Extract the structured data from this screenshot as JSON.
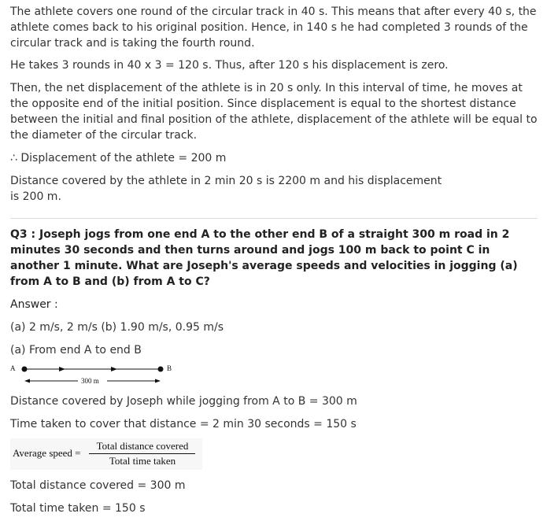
{
  "paragraphs": {
    "p1": "The athlete covers one round of the circular track in 40 s. This means that after every 40 s, the athlete comes back to his original position. Hence, in 140 s he had completed 3 rounds of the circular track and is taking the fourth round.",
    "p2": "He takes 3 rounds in 40 x 3 = 120 s. Thus, after 120 s his displacement is zero.",
    "p3": "Then, the net displacement of the athlete is in 20 s only. In this interval of time, he moves at the opposite end of the initial position. Since displacement is equal to the shortest distance between the initial and final position of the athlete, displacement of the athlete will be equal to the diameter of the circular track.",
    "p4": "∴ Displacement of the athlete = 200 m",
    "p5": "Distance covered by the athlete in 2 min 20 s is 2200 m and his displacement is 200 m."
  },
  "question": "Q3 : Joseph jogs from one end A to the other end B of a straight 300 m road in 2 minutes 30 seconds and then turns around and jogs 100 m back to point C in another 1 minute. What are Joseph's average speeds and velocities in jogging (a) from A to B and (b) from A to C?",
  "answer": {
    "label": "Answer :",
    "result": "(a) 2 m/s, 2 m/s (b) 1.90 m/s, 0.95 m/s",
    "part_a": "(a) From end A to end B",
    "figure": {
      "point_a": "A",
      "point_b": "B",
      "distance": "300 m"
    },
    "distance_line": "Distance covered by Joseph while jogging from A to B = 300 m",
    "time_line": "Time taken to cover that distance = 2 min 30 seconds = 150 s",
    "formula": {
      "lhs": "Average speed =",
      "numerator": "Total distance covered",
      "denominator": "Total time taken"
    },
    "total_distance": "Total distance covered = 300 m",
    "total_time": "Total time taken = 150 s"
  }
}
